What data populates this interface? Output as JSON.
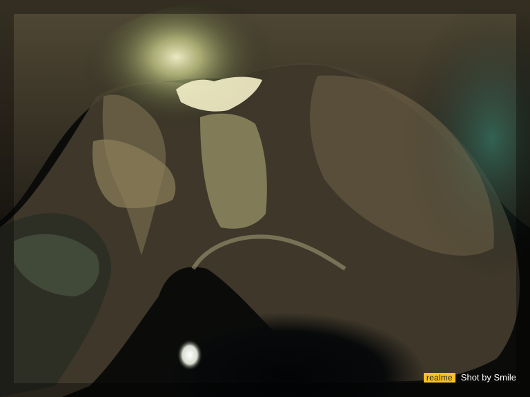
{
  "image": {
    "subject": "cave",
    "colors": {
      "shadow": "#0b0c0a",
      "rock_warm": "#6b5a40",
      "rock_lit": "#d8d49a",
      "skylight": "#f4f0c8",
      "teal_tint": "#2f8a7a"
    }
  },
  "watermark": {
    "brand": "realme",
    "caption": "Shot by Smile",
    "badge_color": "#f7c325"
  }
}
